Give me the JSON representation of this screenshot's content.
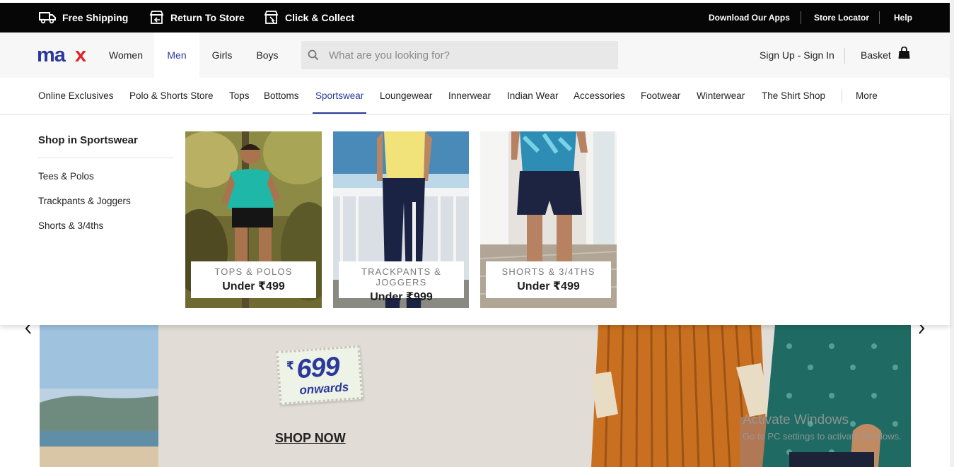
{
  "topbar": {
    "free_shipping": "Free Shipping",
    "return_to_store": "Return To Store",
    "click_collect": "Click & Collect",
    "download_apps": "Download Our Apps",
    "store_locator": "Store Locator",
    "help": "Help"
  },
  "header": {
    "logo": "max",
    "nav": [
      "Women",
      "Men",
      "Girls",
      "Boys"
    ],
    "active_nav": "Men",
    "search_placeholder": "What are you looking for?",
    "signin": "Sign Up - Sign In",
    "basket": "Basket"
  },
  "categories": {
    "items": [
      "Online Exclusives",
      "Polo & Shorts Store",
      "Tops",
      "Bottoms",
      "Sportswear",
      "Loungewear",
      "Innerwear",
      "Indian Wear",
      "Accessories",
      "Footwear",
      "Winterwear",
      "The Shirt Shop",
      "More"
    ],
    "active": "Sportswear"
  },
  "dropdown": {
    "title": "Shop in Sportswear",
    "links": [
      "Tees & Polos",
      "Trackpants & Joggers",
      "Shorts & 3/4ths"
    ],
    "tiles": [
      {
        "category": "TOPS & POLOS",
        "price": "Under ₹499"
      },
      {
        "category": "TRACKPANTS & JOGGERS",
        "price": "Under ₹999"
      },
      {
        "category": "SHORTS & 3/4THS",
        "price": "Under ₹499"
      }
    ]
  },
  "hero": {
    "currency": "₹",
    "price": "699",
    "suffix": "onwards",
    "cta": "SHOP NOW"
  },
  "watermark": {
    "line1": "Activate Windows",
    "line2": "Go to PC settings to activate Windows."
  },
  "colors": {
    "brand_blue": "#2b3a9a",
    "brand_red": "#e0242c",
    "topbar_bg": "#060606"
  }
}
